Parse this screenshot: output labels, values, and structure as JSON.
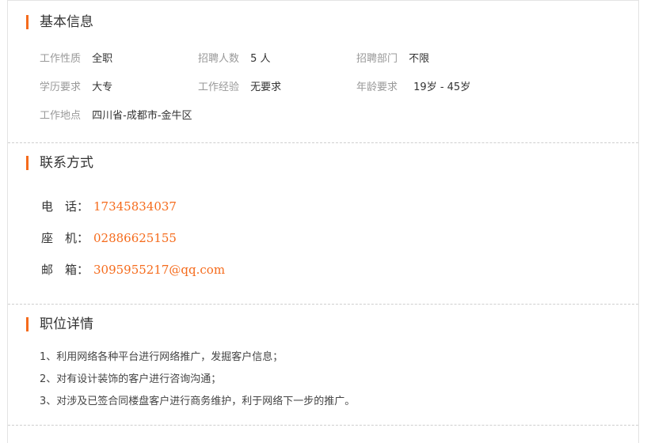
{
  "basic": {
    "title": "基本信息",
    "fields": [
      {
        "label": "工作性质",
        "value": "全职"
      },
      {
        "label": "招聘人数",
        "value": "5 人"
      },
      {
        "label": "招聘部门",
        "value": "不限"
      },
      {
        "label": "学历要求",
        "value": "大专"
      },
      {
        "label": "工作经验",
        "value": "无要求"
      },
      {
        "label": "年龄要求",
        "value": "19岁 - 45岁"
      },
      {
        "label": "工作地点",
        "value": "四川省-成都市-金牛区"
      }
    ]
  },
  "contact": {
    "title": "联系方式",
    "items": [
      {
        "label": "电　话：",
        "value": "17345834037"
      },
      {
        "label": "座　机：",
        "value": "02886625155"
      },
      {
        "label": "邮　箱：",
        "value": "3095955217@qq.com"
      }
    ]
  },
  "details": {
    "title": "职位详情",
    "lines": [
      "1、利用网络各种平台进行网络推广，发掘客户信息；",
      "2、对有设计装饰的客户进行咨询沟通；",
      "3、对涉及已签合同楼盘客户进行商务维护，利于网络下一步的推广。"
    ]
  },
  "colors": {
    "accent": "#f56b1c",
    "label": "#999999",
    "text": "#333333"
  }
}
